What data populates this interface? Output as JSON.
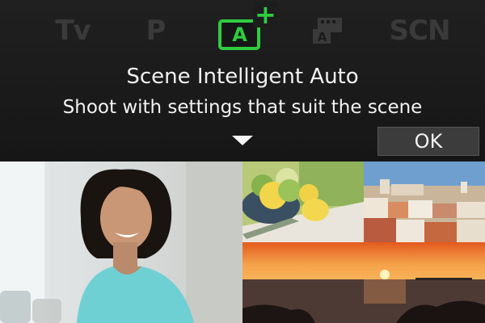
{
  "mode_dial": {
    "items": [
      {
        "label": "Tv"
      },
      {
        "label": "P"
      },
      {
        "label": "A",
        "badge": "+",
        "selected": true,
        "accent": "#2ecc40"
      },
      {
        "label": "A",
        "icon": "creative-auto-icon"
      },
      {
        "label": "SCN"
      }
    ]
  },
  "info": {
    "title": "Scene Intelligent Auto",
    "description": "Shoot with settings that suit the scene"
  },
  "controls": {
    "ok_label": "OK"
  },
  "colors": {
    "accent": "#2ecc40",
    "panel_bg": "#1b1b1b",
    "inactive_icon": "#3a3a3a"
  },
  "photos": [
    "portrait",
    "lemons",
    "town",
    "sunset"
  ]
}
